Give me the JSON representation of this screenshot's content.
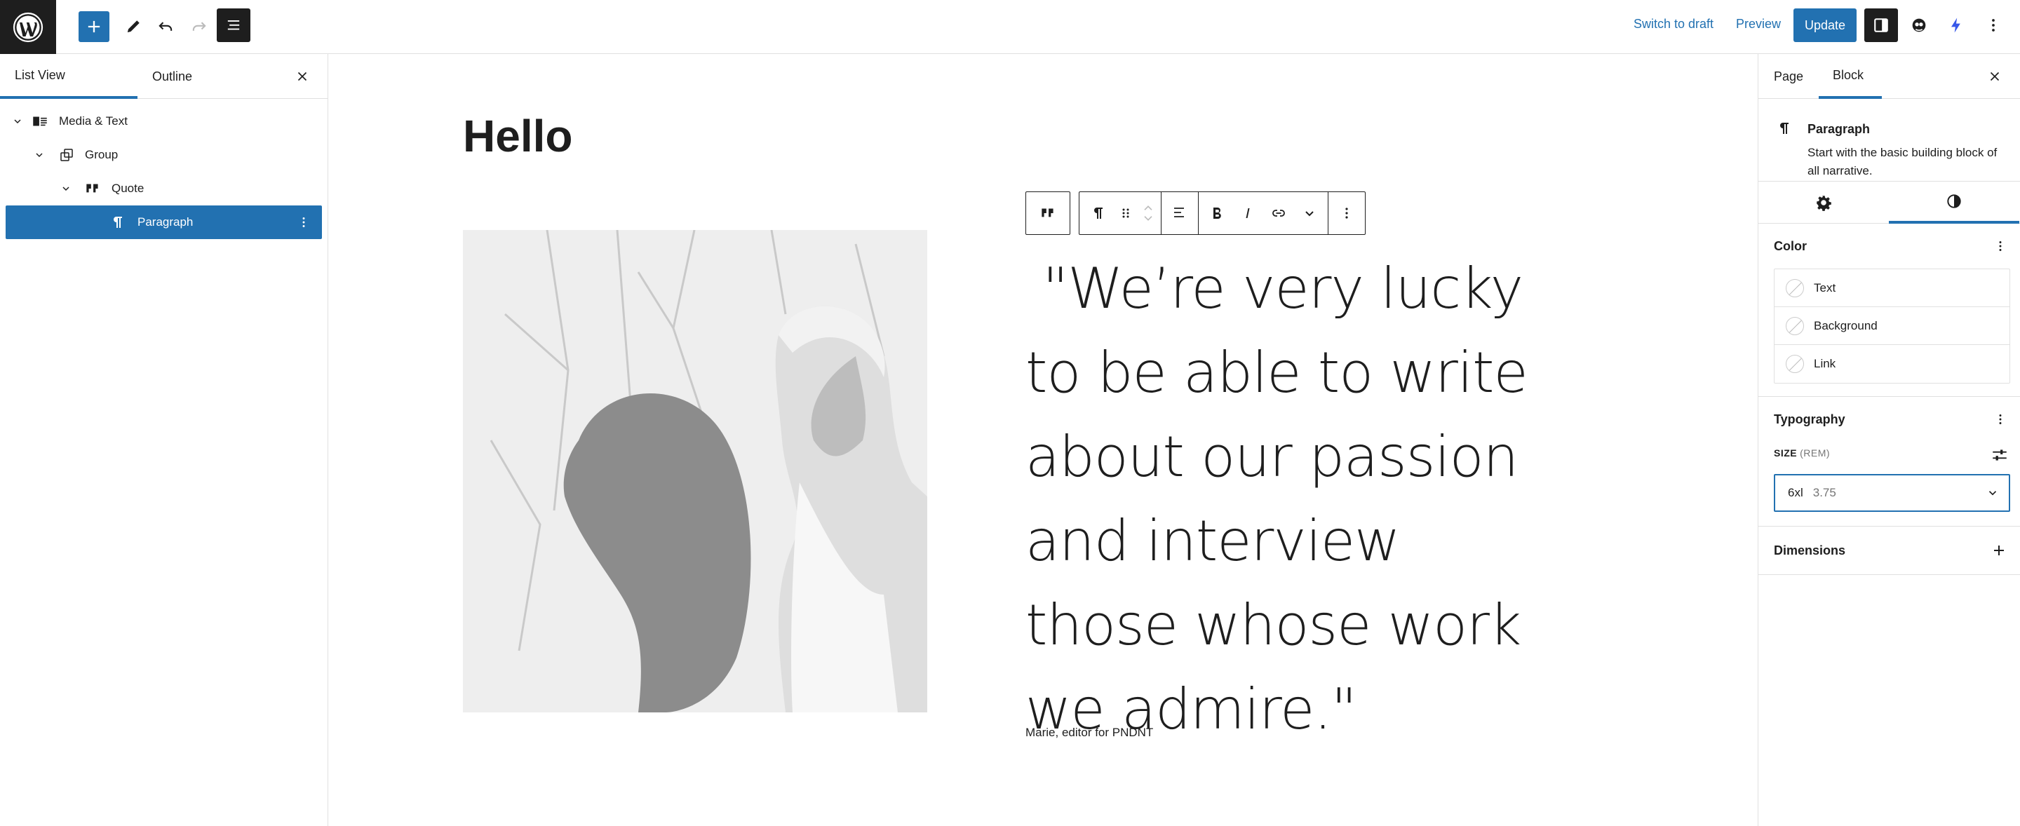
{
  "toolbar": {
    "switch_to_draft": "Switch to draft",
    "preview": "Preview",
    "update": "Update",
    "accent": "#2271b1"
  },
  "left_sidebar": {
    "tabs": [
      {
        "label": "List View",
        "active": true
      },
      {
        "label": "Outline",
        "active": false
      }
    ],
    "tree": [
      {
        "label": "Media & Text",
        "icon": "media-text-icon",
        "level": 1,
        "expanded": true,
        "selected": false
      },
      {
        "label": "Group",
        "icon": "group-icon",
        "level": 2,
        "expanded": true,
        "selected": false
      },
      {
        "label": "Quote",
        "icon": "quote-icon",
        "level": 3,
        "expanded": true,
        "selected": false
      },
      {
        "label": "Paragraph",
        "icon": "paragraph-icon",
        "level": 4,
        "expanded": false,
        "selected": true
      }
    ]
  },
  "canvas": {
    "page_title": "Hello",
    "quote_text": " \"We’re very lucky to be able to write about our passion and interview those whose work we admire.\"",
    "citation": "Marie, editor for PNDNT"
  },
  "right_sidebar": {
    "tabs": [
      {
        "label": "Page",
        "active": false
      },
      {
        "label": "Block",
        "active": true
      }
    ],
    "block_card": {
      "title": "Paragraph",
      "description": "Start with the basic building block of all narrative."
    },
    "color_panel": {
      "title": "Color",
      "items": [
        "Text",
        "Background",
        "Link"
      ]
    },
    "typography_panel": {
      "title": "Typography",
      "size_label": "SIZE",
      "size_unit": "(REM)",
      "size_name": "6xl",
      "size_value": "3.75"
    },
    "dimensions_panel": {
      "title": "Dimensions"
    }
  }
}
